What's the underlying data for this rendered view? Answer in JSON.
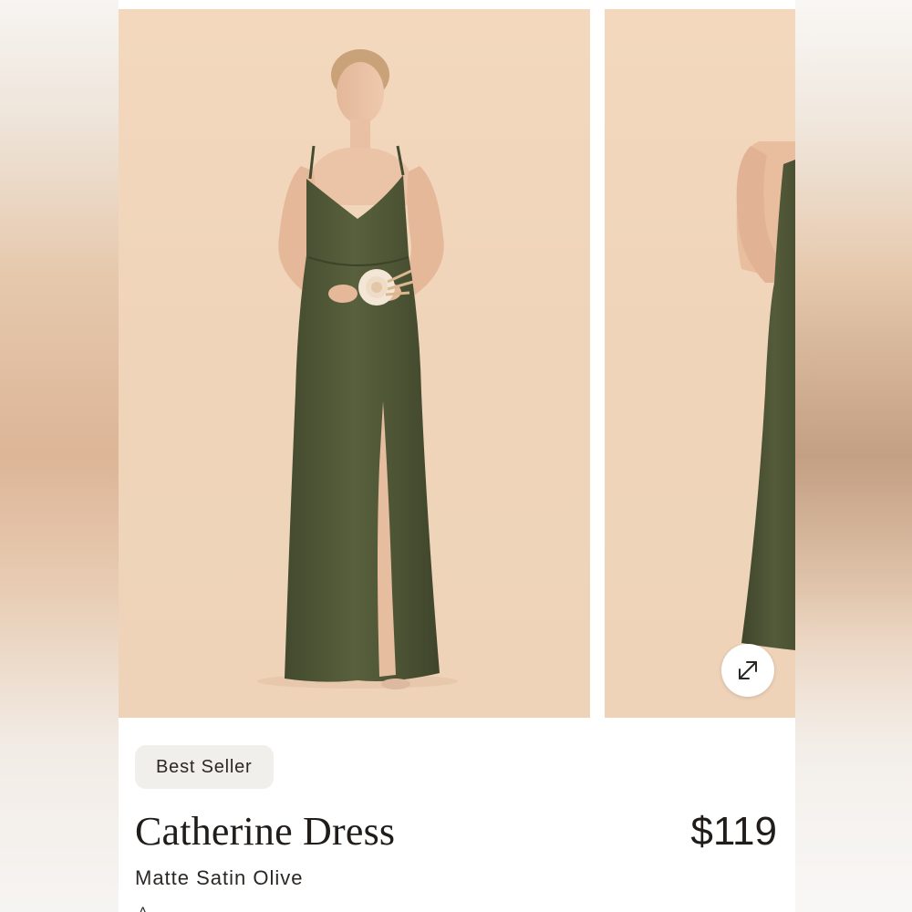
{
  "product": {
    "badge": "Best Seller",
    "name": "Catherine Dress",
    "price": "$119",
    "color_name": "Matte Satin Olive"
  },
  "gallery": {
    "images": [
      {
        "alt": "Model wearing olive satin gown holding a flower, front view"
      },
      {
        "alt": "Model wearing olive satin gown, back view (partially visible)"
      }
    ],
    "expand_icon": "expand-arrows-icon"
  },
  "colors": {
    "dress": "#4f5637",
    "backdrop": "#f0d5bb",
    "badge_bg": "#f1efec",
    "text": "#1f1c1a"
  }
}
